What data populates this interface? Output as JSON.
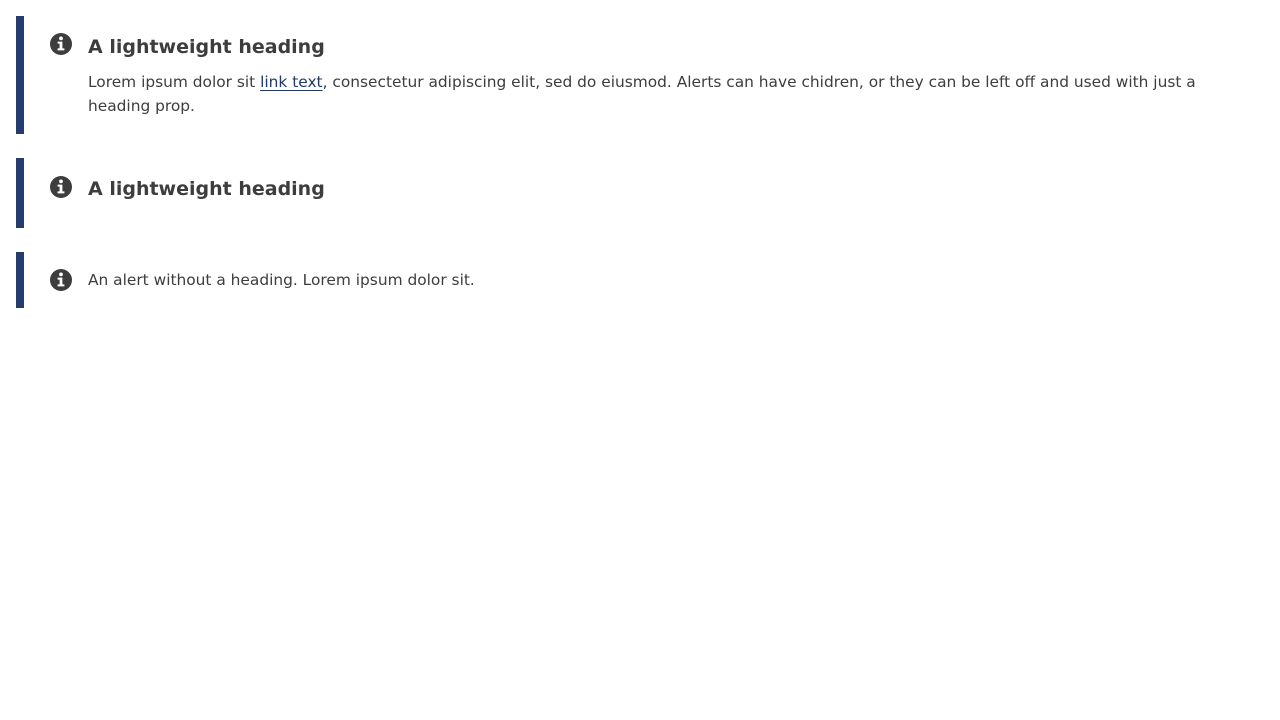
{
  "colors": {
    "alert_border": "#243d6e",
    "text": "#3d3d3d",
    "link": "#1f3a68",
    "icon": "#3d3d3d"
  },
  "alerts": [
    {
      "icon": "info-circle-icon",
      "heading": "A lightweight heading",
      "body_before_link": "Lorem ipsum dolor sit ",
      "link_text": "link text",
      "body_after_link": ", consectetur adipiscing elit, sed do eiusmod. Alerts can have chidren, or they can be left off and used with just a heading prop."
    },
    {
      "icon": "info-circle-icon",
      "heading": "A lightweight heading"
    },
    {
      "icon": "info-circle-icon",
      "body": "An alert without a heading. Lorem ipsum dolor sit."
    }
  ]
}
